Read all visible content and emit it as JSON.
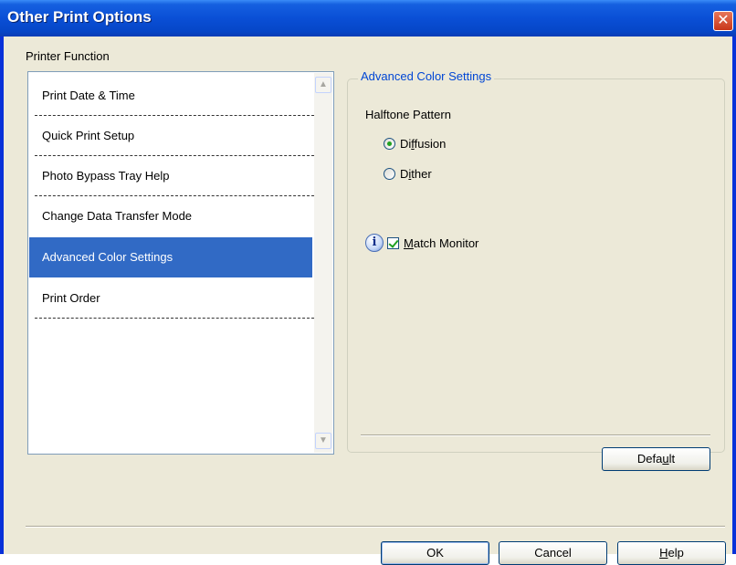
{
  "window": {
    "title": "Other Print Options",
    "close_label": "✕"
  },
  "group": {
    "label": "Printer Function"
  },
  "list": {
    "items": [
      {
        "label": "Print Date & Time",
        "selected": false
      },
      {
        "label": "Quick Print Setup",
        "selected": false
      },
      {
        "label": "Photo Bypass Tray Help",
        "selected": false
      },
      {
        "label": "Change Data Transfer Mode",
        "selected": false
      },
      {
        "label": "Advanced Color Settings",
        "selected": true
      },
      {
        "label": "Print Order",
        "selected": false
      }
    ],
    "scroll_up": "▲",
    "scroll_down": "▼"
  },
  "panel": {
    "legend": "Advanced Color Settings",
    "halftone_label": "Halftone Pattern",
    "radios": [
      {
        "pre": "Di",
        "accel": "f",
        "post": "fusion",
        "checked": true
      },
      {
        "pre": "D",
        "accel": "i",
        "post": "ther",
        "checked": false
      }
    ],
    "match_monitor": {
      "pre": "",
      "accel": "M",
      "post": "atch Monitor",
      "checked": true
    },
    "info_glyph": "i",
    "default_button": {
      "pre": "Defa",
      "accel": "u",
      "post": "lt"
    }
  },
  "buttons": {
    "ok": "OK",
    "cancel": "Cancel",
    "help": {
      "pre": "",
      "accel": "H",
      "post": "elp"
    }
  },
  "colors": {
    "title_bar": "#0a4fd6",
    "selection": "#316ac5",
    "legend": "#0046d5",
    "dialog_bg": "#ece9d8"
  }
}
